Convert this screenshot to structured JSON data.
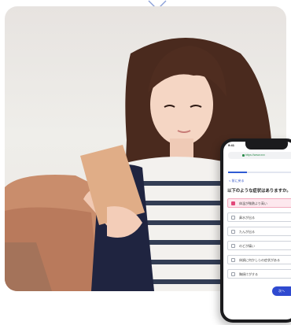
{
  "phone": {
    "status_time": "9:41",
    "url": "https://www.xxx",
    "back_label": "< 前に戻る",
    "question": "以下のような症状はありますか。",
    "progress": 0.25,
    "options": [
      {
        "label": "体温が微熱より高い",
        "selected": true
      },
      {
        "label": "鼻水が出る",
        "selected": false
      },
      {
        "label": "たんが出る",
        "selected": false
      },
      {
        "label": "のどが痛い",
        "selected": false
      },
      {
        "label": "体調に何かしらの症状がある",
        "selected": false
      },
      {
        "label": "胸焼けがする",
        "selected": false
      }
    ],
    "next_label": "次へ"
  },
  "colors": {
    "accent": "#2f4ad0",
    "selected_bg": "#fde8ee",
    "selected_check": "#e2477a",
    "phone_frame": "#1b1b1d"
  },
  "icons": [
    "chevron-down-icon"
  ]
}
